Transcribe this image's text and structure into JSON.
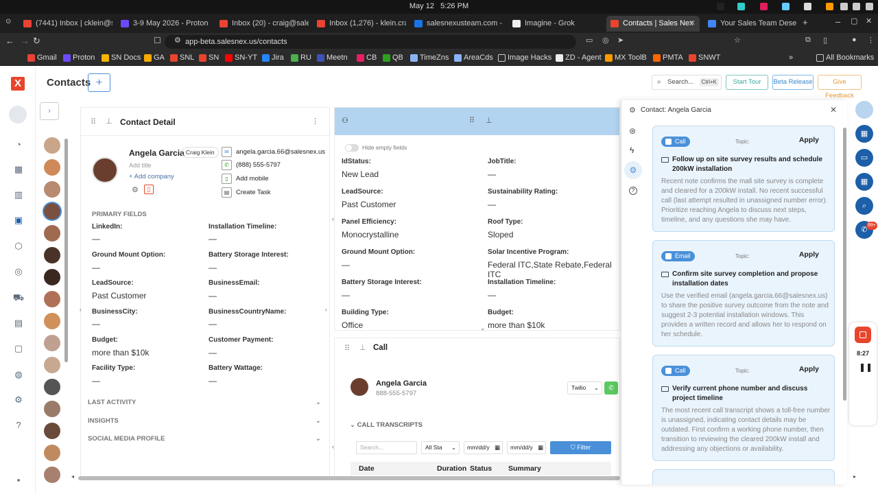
{
  "system": {
    "date": "May 12",
    "time": "5:26 PM"
  },
  "tabs": [
    {
      "title": "(7441) Inbox | cklein@sa",
      "color": "#5b5bd6"
    },
    {
      "title": "3-9 May 2026 - Proton C",
      "color": "#6d4aff"
    },
    {
      "title": "Inbox (20) - craig@sales",
      "color": "#ea4335"
    },
    {
      "title": "Inbox (1,276) - klein.cra",
      "color": "#ea4335"
    },
    {
      "title": "salesnexusteam.com - C",
      "color": "#1a73e8"
    },
    {
      "title": "Imagine - Grok",
      "color": "#111111"
    },
    {
      "title": "Contacts | Sales Nex",
      "color": "#e8452c"
    },
    {
      "title": "Your Sales Team Deserv",
      "color": "#4285f4"
    }
  ],
  "url": "app-beta.salesnex.us/contacts",
  "bookmarks": [
    "Gmail",
    "Proton",
    "SN Docs",
    "GA",
    "SNL",
    "SN",
    "SN-YT",
    "Jira",
    "RU",
    "Meetn",
    "CB",
    "QB",
    "TimeZns",
    "AreaCds",
    "Image Hacks",
    "ZD - Agent",
    "MX ToolB",
    "PMTA",
    "SNWT"
  ],
  "all_bookmarks": "All Bookmarks",
  "header": {
    "title": "Contacts",
    "add": "+",
    "search": "Search...",
    "shortcut": "Ctrl+K",
    "start_tour": "Start Tour",
    "beta": "Beta Release",
    "feedback": "Give Feedback"
  },
  "contact_detail": {
    "title": "Contact Detail",
    "name": "Angela Garcia",
    "owner": "Craig Klein",
    "add_title": "Add title",
    "add_company": "+ Add company",
    "email": "angela.garcia.66@salesnex.us",
    "phone": "(888) 555-5797",
    "add_mobile": "Add mobile",
    "create_task": "Create Task",
    "primary_fields": "PRIMARY FIELDS",
    "fields": [
      {
        "label": "LinkedIn:",
        "value": "—"
      },
      {
        "label": "Installation Timeline:",
        "value": "—"
      },
      {
        "label": "Ground Mount Option:",
        "value": "—"
      },
      {
        "label": "Battery Storage Interest:",
        "value": "—"
      },
      {
        "label": "LeadSource:",
        "value": "Past Customer"
      },
      {
        "label": "BusinessEmail:",
        "value": "—"
      },
      {
        "label": "BusinessCity:",
        "value": "—"
      },
      {
        "label": "BusinessCountryName:",
        "value": "—"
      },
      {
        "label": "Budget:",
        "value": "more than $10k"
      },
      {
        "label": "Customer Payment:",
        "value": "—"
      },
      {
        "label": "Facility Type:",
        "value": "—"
      },
      {
        "label": "Battery Wattage:",
        "value": "—"
      }
    ],
    "sections": [
      "LAST ACTIVITY",
      "INSIGHTS",
      "SOCIAL MEDIA PROFILE"
    ]
  },
  "fields_panel": {
    "hide_empty": "Hide empty fields",
    "fields": [
      {
        "label": "IdStatus:",
        "value": "New Lead"
      },
      {
        "label": "JobTitle:",
        "value": "—"
      },
      {
        "label": "LeadSource:",
        "value": "Past Customer"
      },
      {
        "label": "Sustainability Rating:",
        "value": "—"
      },
      {
        "label": "Panel Efficiency:",
        "value": "Monocrystalline"
      },
      {
        "label": "Roof Type:",
        "value": "Sloped"
      },
      {
        "label": "Ground Mount Option:",
        "value": "—"
      },
      {
        "label": "Solar Incentive Program:",
        "value": "Federal ITC,State Rebate,Federal ITC"
      },
      {
        "label": "Battery Storage Interest:",
        "value": "—"
      },
      {
        "label": "Installation Timeline:",
        "value": "—"
      },
      {
        "label": "Building Type:",
        "value": "Office"
      },
      {
        "label": "Budget:",
        "value": "more than $10k"
      }
    ]
  },
  "call_panel": {
    "title": "Call",
    "name": "Angela Garcia",
    "phone": "888-555-5797",
    "provider": "Twilio",
    "transcripts": "CALL TRANSCRIPTS",
    "search": "Search...",
    "status": "All Sta",
    "date1": "mm/dd/y",
    "date2": "mm/dd/y",
    "filter": "Filter",
    "columns": [
      "Date",
      "Duration",
      "Status",
      "Summary"
    ]
  },
  "ai_panel": {
    "title": "Contact: Angela Garcia",
    "topic_label": "Topic:",
    "apply": "Apply",
    "cards": [
      {
        "type": "Call",
        "title": "Follow up on site survey results and schedule 200kW installation",
        "desc": "Recent note confirms the mall site survey is complete and cleared for a 200kW install. No recent successful call (last attempt resulted in unassigned number error). Prioritize reaching Angela to discuss next steps, timeline, and any questions she may have."
      },
      {
        "type": "Email",
        "title": "Confirm site survey completion and propose installation dates",
        "desc": "Use the verified email (angela.garcia.66@salesnex.us) to share the positive survey outcome from the note and suggest 2-3 potential installation windows. This provides a written record and allows her to respond on her schedule."
      },
      {
        "type": "Call",
        "title": "Verify current phone number and discuss project timeline",
        "desc": "The most recent call transcript shows a toll-free number is unassigned, indicating contact details may be outdated. First confirm a working phone number, then transition to reviewing the cleared 200kW install and addressing any objections or availability."
      }
    ]
  },
  "right_strip": {
    "badge": "99+"
  },
  "recorder": {
    "time": "8:27"
  },
  "colors": {
    "accent": "#1d5fa8",
    "card_bg": "#eaf4fc",
    "chip": "#4a90d9",
    "header_blue": "#b3d4f0"
  }
}
